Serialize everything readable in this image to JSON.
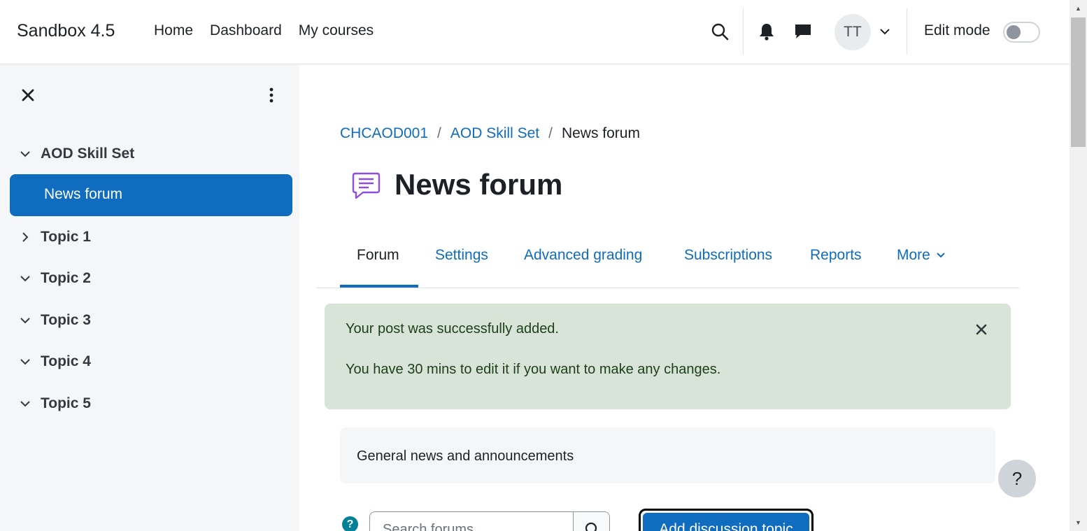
{
  "navbar": {
    "brand": "Sandbox 4.5",
    "links": [
      "Home",
      "Dashboard",
      "My courses"
    ],
    "user_initials": "TT",
    "edit_mode_label": "Edit mode",
    "edit_mode_on": false
  },
  "drawer": {
    "parent_section": "AOD Skill Set",
    "active_item": "News forum",
    "sections": [
      "Topic 1",
      "Topic 2",
      "Topic 3",
      "Topic 4",
      "Topic 5"
    ]
  },
  "breadcrumb": {
    "course": "CHCAOD001",
    "section": "AOD Skill Set",
    "current": "News forum",
    "separator": "/"
  },
  "page": {
    "title": "News forum",
    "forum_icon_color": "#8e4ee4"
  },
  "tabs": [
    "Forum",
    "Settings",
    "Advanced grading",
    "Subscriptions",
    "Reports",
    "More"
  ],
  "active_tab": "Forum",
  "alert": {
    "line1": "Your post was successfully added.",
    "line2": "You have 30 mins to edit it if you want to make any changes."
  },
  "intro": "General news and announcements",
  "search": {
    "placeholder": "Search forums"
  },
  "add_topic_label": "Add discussion topic",
  "help_button": "?",
  "help_badge": "?",
  "colors": {
    "primary": "#0f6cbf",
    "success_bg": "#d7e4d7",
    "success_text": "#1c3f1a",
    "drawer_bg": "#f5f6f8"
  }
}
